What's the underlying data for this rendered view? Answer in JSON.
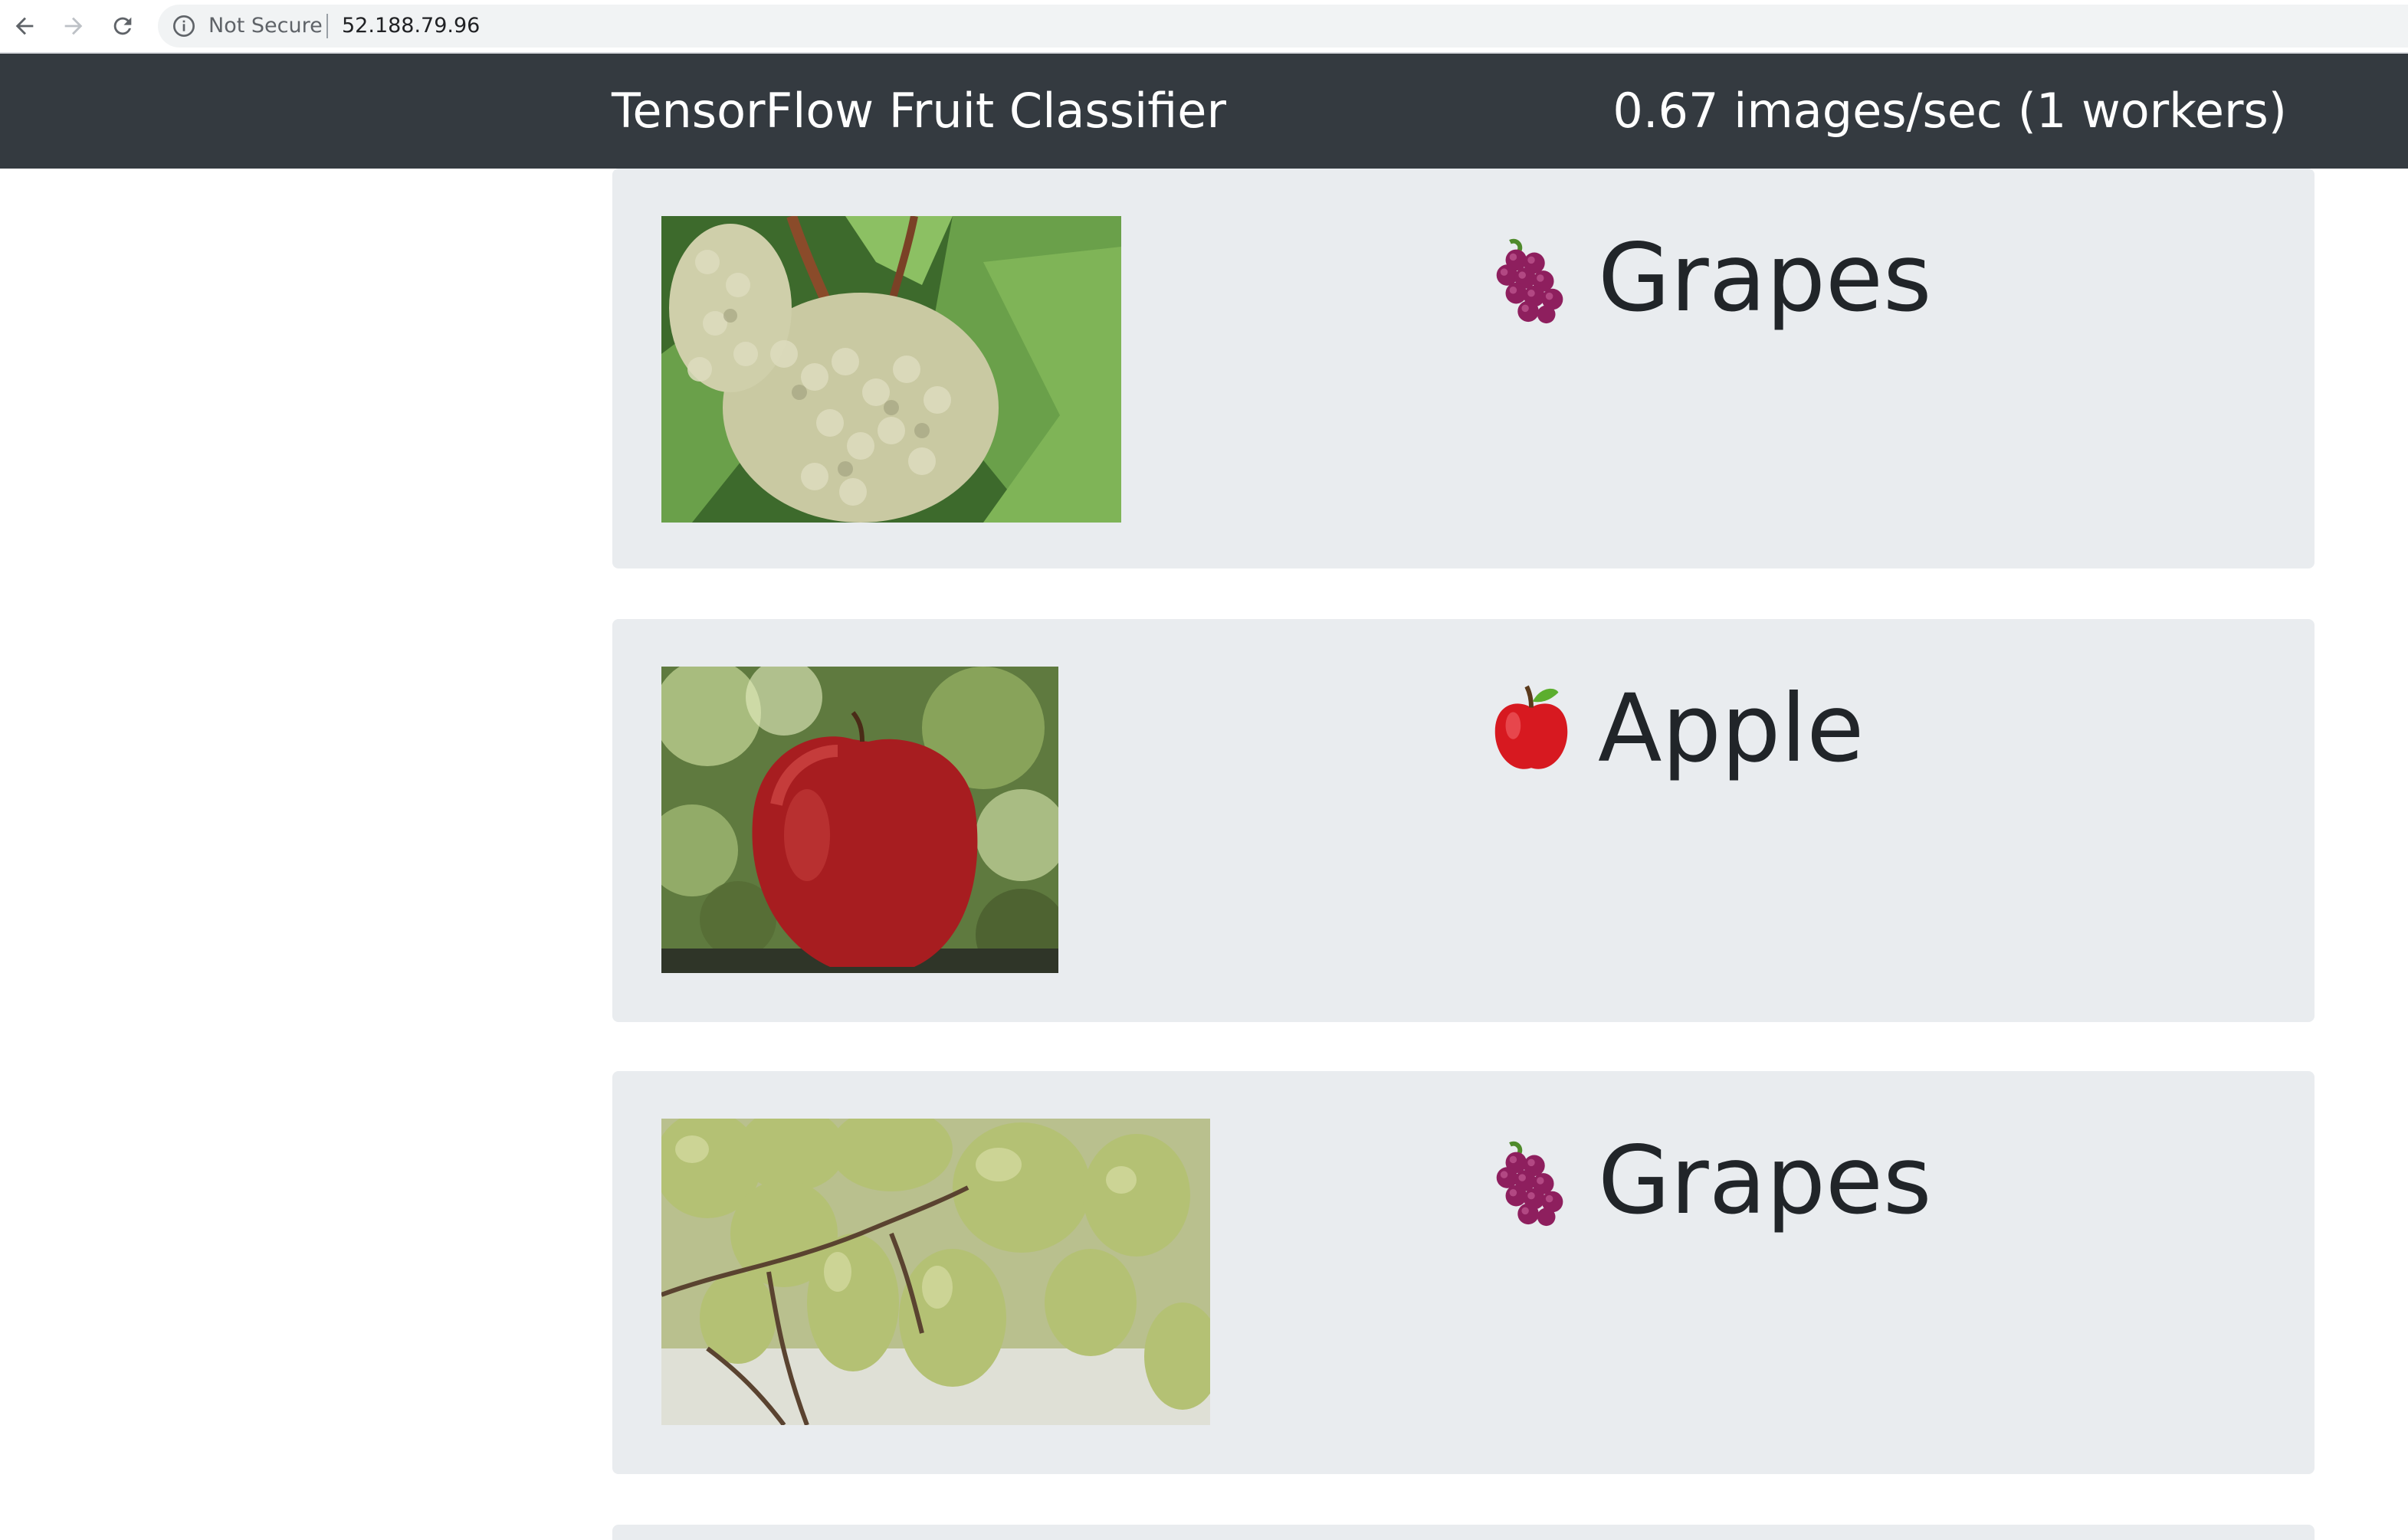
{
  "browser": {
    "security_label": "Not Secure",
    "url": "52.188.79.96"
  },
  "navbar": {
    "title": "TensorFlow Fruit Classifier",
    "throughput": "0.67 images/sec (1 workers)"
  },
  "results": [
    {
      "label": "Grapes",
      "icon": "grapes-icon"
    },
    {
      "label": "Apple",
      "icon": "apple-icon"
    },
    {
      "label": "Grapes",
      "icon": "grapes-icon"
    }
  ],
  "colors": {
    "navbar_bg": "#343a40",
    "card_bg": "#e9ecef",
    "label_text": "#212529"
  }
}
